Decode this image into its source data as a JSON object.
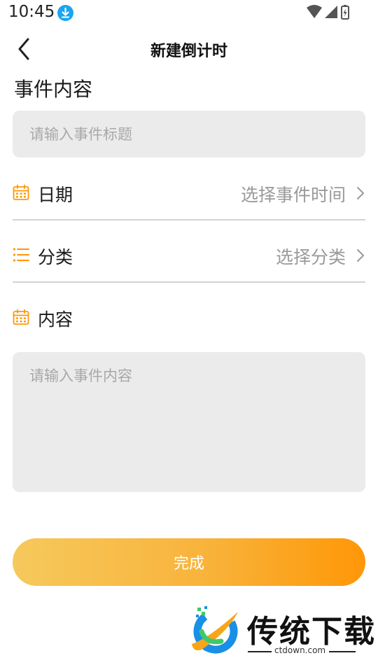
{
  "status_bar": {
    "time": "10:45"
  },
  "nav": {
    "title": "新建倒计时"
  },
  "form": {
    "section_title": "事件内容",
    "title_placeholder": "请输入事件标题",
    "date_label": "日期",
    "date_value": "选择事件时间",
    "category_label": "分类",
    "category_value": "选择分类",
    "content_label": "内容",
    "content_placeholder": "请输入事件内容",
    "submit_label": "完成"
  },
  "watermark": {
    "brand": "传统下载",
    "url": "ctdown.com"
  },
  "colors": {
    "accent": "#ff9707",
    "gradient_start": "#f6c95c",
    "input_bg": "#ebebeb",
    "download_badge": "#1aa5f0"
  },
  "icons": {
    "back": "chevron-left-icon",
    "date": "calendar-icon",
    "category": "list-icon",
    "content": "calendar-icon",
    "arrow": "chevron-right-icon"
  }
}
